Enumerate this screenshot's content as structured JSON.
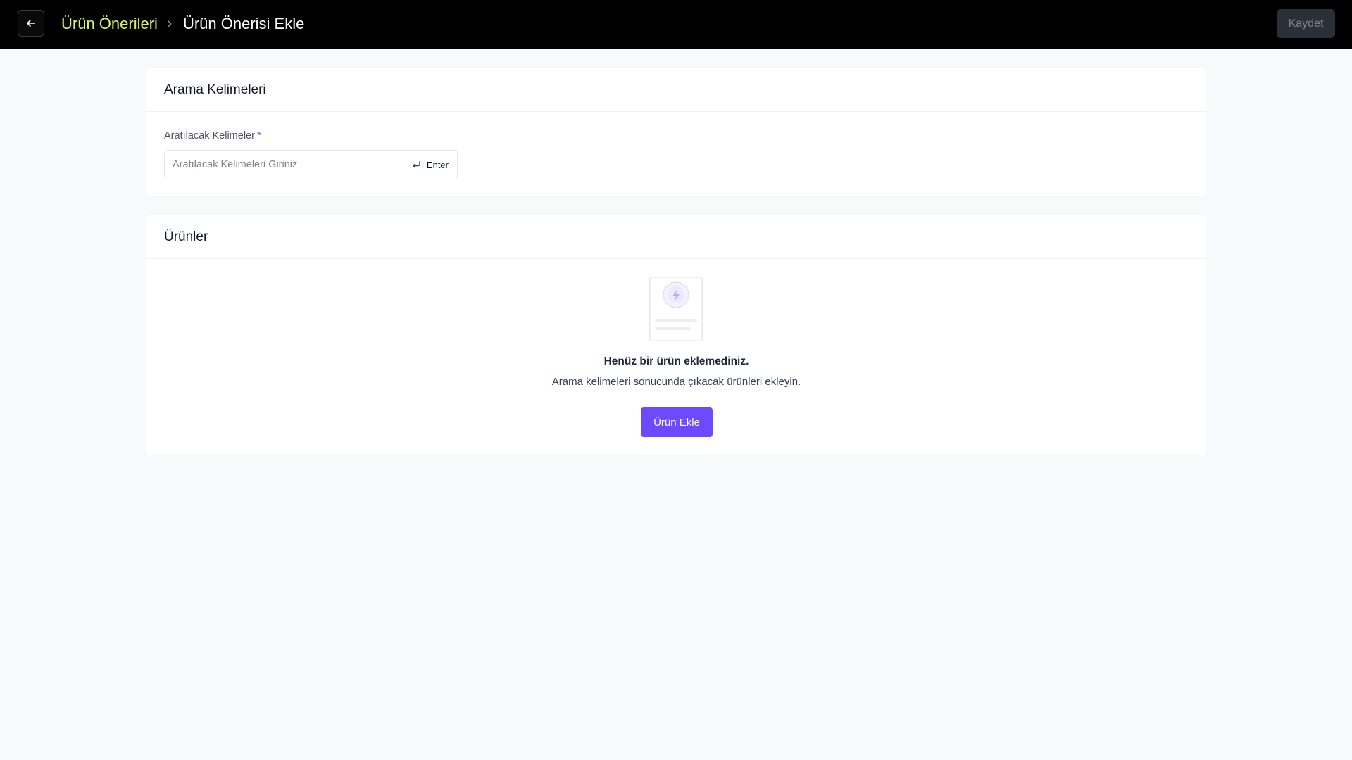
{
  "header": {
    "back_icon": "arrow-left-icon",
    "breadcrumb": {
      "parent": "Ürün Önerileri",
      "separator_icon": "chevron-right-icon",
      "current": "Ürün Önerisi Ekle"
    },
    "save_label": "Kaydet"
  },
  "keywords_section": {
    "title": "Arama Kelimeleri",
    "field_label": "Aratılacak Kelimeler",
    "required_marker": "*",
    "input_value": "",
    "input_placeholder": "Aratılacak Kelimeleri Giriniz",
    "enter_icon": "enter-return-icon",
    "enter_hint": "Enter"
  },
  "products_section": {
    "title": "Ürünler",
    "empty_icon": "empty-document-icon",
    "empty_title": "Henüz bir ürün eklemediniz.",
    "empty_subtitle": "Arama kelimeleri sonucunda çıkacak ürünleri ekleyin.",
    "add_button_label": "Ürün Ekle"
  },
  "colors": {
    "topbar_bg": "#000000",
    "breadcrumb_link": "#d9f26b",
    "accent": "#6d4aff",
    "page_bg": "#f8f9fb",
    "save_button_bg": "#2b2f37",
    "save_button_text": "#7d838e"
  }
}
